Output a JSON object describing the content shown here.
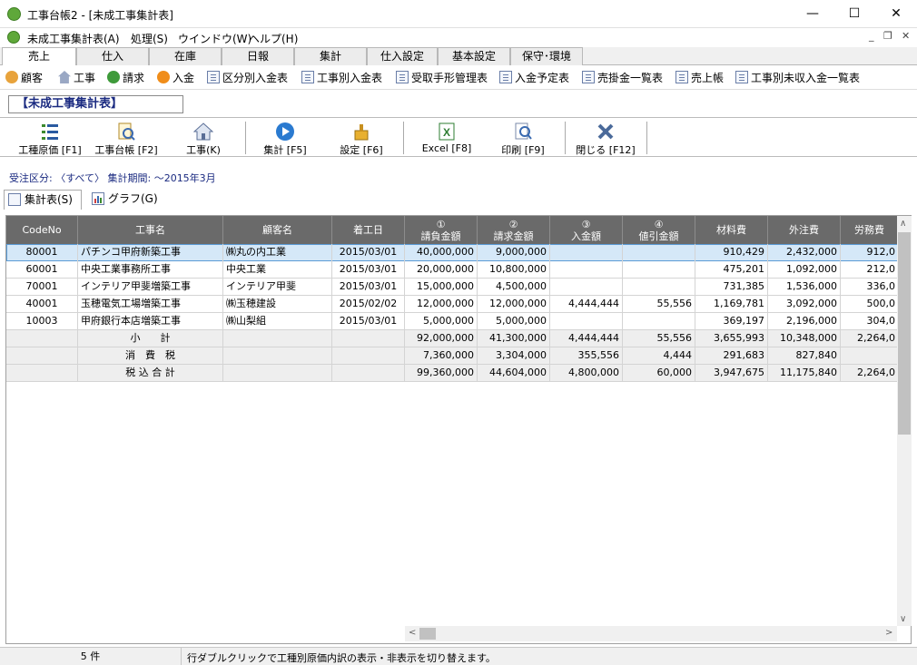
{
  "window": {
    "title": "工事台帳2 - [未成工事集計表]",
    "min": "—",
    "max": "☐",
    "close": "✕"
  },
  "menu": {
    "items": [
      "未成工事集計表(A)",
      "処理(S)",
      "ウインドウ(W)",
      "ヘルプ(H)"
    ],
    "mdi_min": "_",
    "mdi_restore": "❐",
    "mdi_close": "✕"
  },
  "tabs": [
    "売上",
    "仕入",
    "在庫",
    "日報",
    "集計",
    "仕入設定",
    "基本設定",
    "保守･環境"
  ],
  "subnav": [
    "顧客",
    "工事",
    "請求",
    "入金",
    "区分別入金表",
    "工事別入金表",
    "受取手形管理表",
    "入金予定表",
    "売掛金一覧表",
    "売上帳",
    "工事別未収入金一覧表"
  ],
  "header_box": "【未成工事集計表】",
  "toolbar": [
    "工種原価 [F1]",
    "工事台帳 [F2]",
    "工事(K)",
    "集計 [F5]",
    "設定 [F6]",
    "Excel [F8]",
    "印刷 [F9]",
    "閉じる [F12]"
  ],
  "filter": "受注区分: 〈すべて〉 集計期間: ～2015年3月",
  "inner_tabs": [
    "集計表(S)",
    "グラフ(G)"
  ],
  "grid": {
    "columns": [
      {
        "l1": "",
        "l2": "CodeNo"
      },
      {
        "l1": "",
        "l2": "工事名"
      },
      {
        "l1": "",
        "l2": "顧客名"
      },
      {
        "l1": "",
        "l2": "着工日"
      },
      {
        "l1": "①",
        "l2": "請負金額"
      },
      {
        "l1": "②",
        "l2": "請求金額"
      },
      {
        "l1": "③",
        "l2": "入金額"
      },
      {
        "l1": "④",
        "l2": "値引金額"
      },
      {
        "l1": "",
        "l2": "材料費"
      },
      {
        "l1": "",
        "l2": "外注費"
      },
      {
        "l1": "",
        "l2": "労務費"
      }
    ],
    "rows": [
      [
        "80001",
        "パチンコ甲府新築工事",
        "㈱丸の内工業",
        "2015/03/01",
        "40,000,000",
        "9,000,000",
        "",
        "",
        "910,429",
        "2,432,000",
        "912,0"
      ],
      [
        "60001",
        "中央工業事務所工事",
        "中央工業",
        "2015/03/01",
        "20,000,000",
        "10,800,000",
        "",
        "",
        "475,201",
        "1,092,000",
        "212,0"
      ],
      [
        "70001",
        "インテリア甲斐増築工事",
        "インテリア甲斐",
        "2015/03/01",
        "15,000,000",
        "4,500,000",
        "",
        "",
        "731,385",
        "1,536,000",
        "336,0"
      ],
      [
        "40001",
        "玉穂電気工場増築工事",
        "㈱玉穂建設",
        "2015/02/02",
        "12,000,000",
        "12,000,000",
        "4,444,444",
        "55,556",
        "1,169,781",
        "3,092,000",
        "500,0"
      ],
      [
        "10003",
        "甲府銀行本店増築工事",
        "㈱山梨組",
        "2015/03/01",
        "5,000,000",
        "5,000,000",
        "",
        "",
        "369,197",
        "2,196,000",
        "304,0"
      ]
    ],
    "summary": [
      [
        "",
        "小　　計",
        "",
        "",
        "92,000,000",
        "41,300,000",
        "4,444,444",
        "55,556",
        "3,655,993",
        "10,348,000",
        "2,264,0"
      ],
      [
        "",
        "消　費　税",
        "",
        "",
        "7,360,000",
        "3,304,000",
        "355,556",
        "4,444",
        "291,683",
        "827,840",
        ""
      ],
      [
        "",
        "税 込 合 計",
        "",
        "",
        "99,360,000",
        "44,604,000",
        "4,800,000",
        "60,000",
        "3,947,675",
        "11,175,840",
        "2,264,0"
      ]
    ]
  },
  "status": {
    "count": "5 件",
    "message": "行ダブルクリックで工種別原価内訳の表示・非表示を切り替えます。"
  },
  "scroll_arrows": {
    "up": "∧",
    "down": "∨",
    "left": "<",
    "right": ">"
  },
  "colors": {
    "header_bg": "#6a6a6a",
    "selected_row": "#d5e8f8",
    "accent_text": "#1a2a80"
  }
}
